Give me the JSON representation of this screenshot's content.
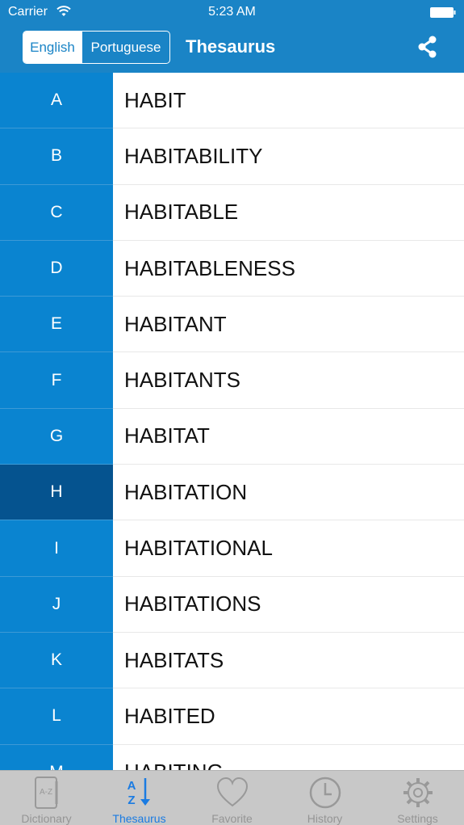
{
  "status_bar": {
    "carrier": "Carrier",
    "time": "5:23 AM"
  },
  "header": {
    "language_toggle": {
      "selected": "English",
      "options": [
        "English",
        "Portuguese"
      ]
    },
    "title": "Thesaurus",
    "share_icon": "share-icon"
  },
  "colors": {
    "header": "#1a84c6",
    "index_bar": "#0a84d0",
    "index_selected": "#05538f",
    "tab_active": "#1a7be2",
    "tab_inactive": "#959595"
  },
  "index": {
    "letters": [
      "A",
      "B",
      "C",
      "D",
      "E",
      "F",
      "G",
      "H",
      "I",
      "J",
      "K",
      "L",
      "M"
    ],
    "selected": "H"
  },
  "words": [
    "HABIT",
    "HABITABILITY",
    "HABITABLE",
    "HABITABLENESS",
    "HABITANT",
    "HABITANTS",
    "HABITAT",
    "HABITATION",
    "HABITATIONAL",
    "HABITATIONS",
    "HABITATS",
    "HABITED",
    "HABITING"
  ],
  "tabbar": {
    "items": [
      {
        "label": "Dictionary",
        "icon": "book-az-icon"
      },
      {
        "label": "Thesaurus",
        "icon": "sort-az-icon"
      },
      {
        "label": "Favorite",
        "icon": "heart-icon"
      },
      {
        "label": "History",
        "icon": "clock-icon"
      },
      {
        "label": "Settings",
        "icon": "gear-icon"
      }
    ],
    "active": "Thesaurus"
  }
}
